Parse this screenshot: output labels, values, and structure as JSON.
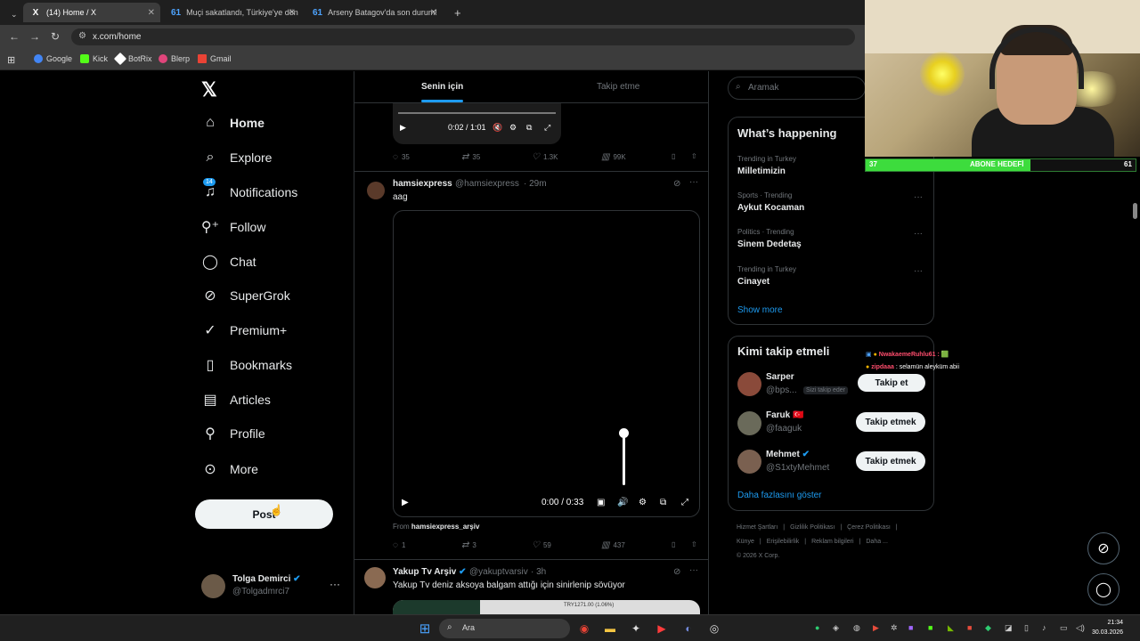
{
  "browser": {
    "tabs": [
      {
        "label": "(14) Home / X",
        "icon": "X"
      },
      {
        "label": "Muçi sakatlandı, Türkiye'ye dön",
        "icon": "61"
      },
      {
        "label": "Arseny Batagov'da son durum!",
        "icon": "61"
      }
    ],
    "new_tab": "+",
    "url": "x.com/home",
    "bookmarks": [
      {
        "label": "Google",
        "color": "#4285f4"
      },
      {
        "label": "Kick",
        "color": "#53fc18"
      },
      {
        "label": "BotRix",
        "color": "#ffffff"
      },
      {
        "label": "Blerp",
        "color": "#e0457b"
      },
      {
        "label": "Gmail",
        "color": "#ea4335"
      }
    ]
  },
  "nav": {
    "logo": "𝕏",
    "items": [
      {
        "label": "Home",
        "icon": "home-icon",
        "glyph": "⌂"
      },
      {
        "label": "Explore",
        "icon": "search-icon",
        "glyph": "⌕"
      },
      {
        "label": "Notifications",
        "icon": "bell-icon",
        "glyph": "🔔",
        "badge": "14"
      },
      {
        "label": "Follow",
        "icon": "person-plus-icon",
        "glyph": "👤"
      },
      {
        "label": "Chat",
        "icon": "chat-icon",
        "glyph": "◯"
      },
      {
        "label": "SuperGrok",
        "icon": "grok-icon",
        "glyph": "⊘"
      },
      {
        "label": "Premium+",
        "icon": "verified-icon",
        "glyph": "✓"
      },
      {
        "label": "Bookmarks",
        "icon": "bookmark-icon",
        "glyph": "▯"
      },
      {
        "label": "Articles",
        "icon": "article-icon",
        "glyph": "▤"
      },
      {
        "label": "Profile",
        "icon": "person-icon",
        "glyph": "⚲"
      },
      {
        "label": "More",
        "icon": "more-icon",
        "glyph": "⋯"
      }
    ],
    "post_button": "Post",
    "account": {
      "name": "Tolga Demirci",
      "handle": "@Tolgadmrci7",
      "more": "···"
    }
  },
  "feed": {
    "tabs": {
      "selected": "Senin için",
      "other": "Takip etme"
    },
    "prev_video": {
      "time": "0:02 / 1:01"
    },
    "prev_actions": {
      "replies": "35",
      "reposts": "35",
      "likes": "1.3K",
      "views": "99K"
    },
    "post1": {
      "name": "hamsiexpress",
      "handle": "@hamsiexpress",
      "time": "· 29m",
      "text": "aag",
      "video_time": "0:00 / 0:33",
      "volume": 1.0,
      "from_label": "From",
      "from_source": "hamsiexpress_arşiv",
      "replies": "1",
      "reposts": "3",
      "likes": "59",
      "views": "437"
    },
    "post2": {
      "name": "Yakup Tv Arşiv",
      "handle": "@yakuptvarsiv",
      "time": "· 3h",
      "text": "Yakup Tv deniz aksoya balgam attığı için sinirlenip sövüyor",
      "thumb_caption": "TRY1271.00 (1.06%)"
    }
  },
  "right": {
    "search_placeholder": "Aramak",
    "happening": {
      "title": "What’s happening",
      "trends": [
        {
          "category": "Trending in Turkey",
          "name": "Milletimizin"
        },
        {
          "category": "Sports · Trending",
          "name": "Aykut Kocaman"
        },
        {
          "category": "Politics · Trending",
          "name": "Sinem Dedetaş"
        },
        {
          "category": "Trending in Turkey",
          "name": "Cinayet"
        }
      ],
      "show_more": "Show more"
    },
    "who_to_follow": {
      "title": "Kimi takip etmeli",
      "users": [
        {
          "name": "Sarper",
          "handle": "@bps...",
          "follows_you": "Sizi takip eder",
          "button": "Takip et"
        },
        {
          "name": "Faruk",
          "flag": "🇹🇷",
          "handle": "@faaguk",
          "button": "Takip etmek"
        },
        {
          "name": "Mehmet",
          "handle": "@S1xtyMehmet",
          "button": "Takip etmek"
        }
      ],
      "show_more": "Daha fazlasını göster"
    },
    "footer": [
      "Hizmet Şartları",
      "|",
      "Gizlilik Politikası",
      "|",
      "Çerez Politikası",
      "|",
      "Künye",
      "|",
      "Erişilebilirlik",
      "|",
      "Reklam bilgileri",
      "|",
      "Daha ...",
      "© 2026 X Corp."
    ]
  },
  "overlay": {
    "chat": [
      {
        "user": "NwakaemeRuhlu61 :",
        "message": "🟩"
      },
      {
        "user": "zipdaaa",
        "message": ": selamün aleyküm abii"
      }
    ],
    "sub_goal": {
      "current": "37",
      "label": "ABONE HEDEFİ",
      "target": "61",
      "progress": 0.61
    }
  },
  "taskbar": {
    "search": "Ara",
    "time": "21:34",
    "date": "30.03.2026"
  }
}
